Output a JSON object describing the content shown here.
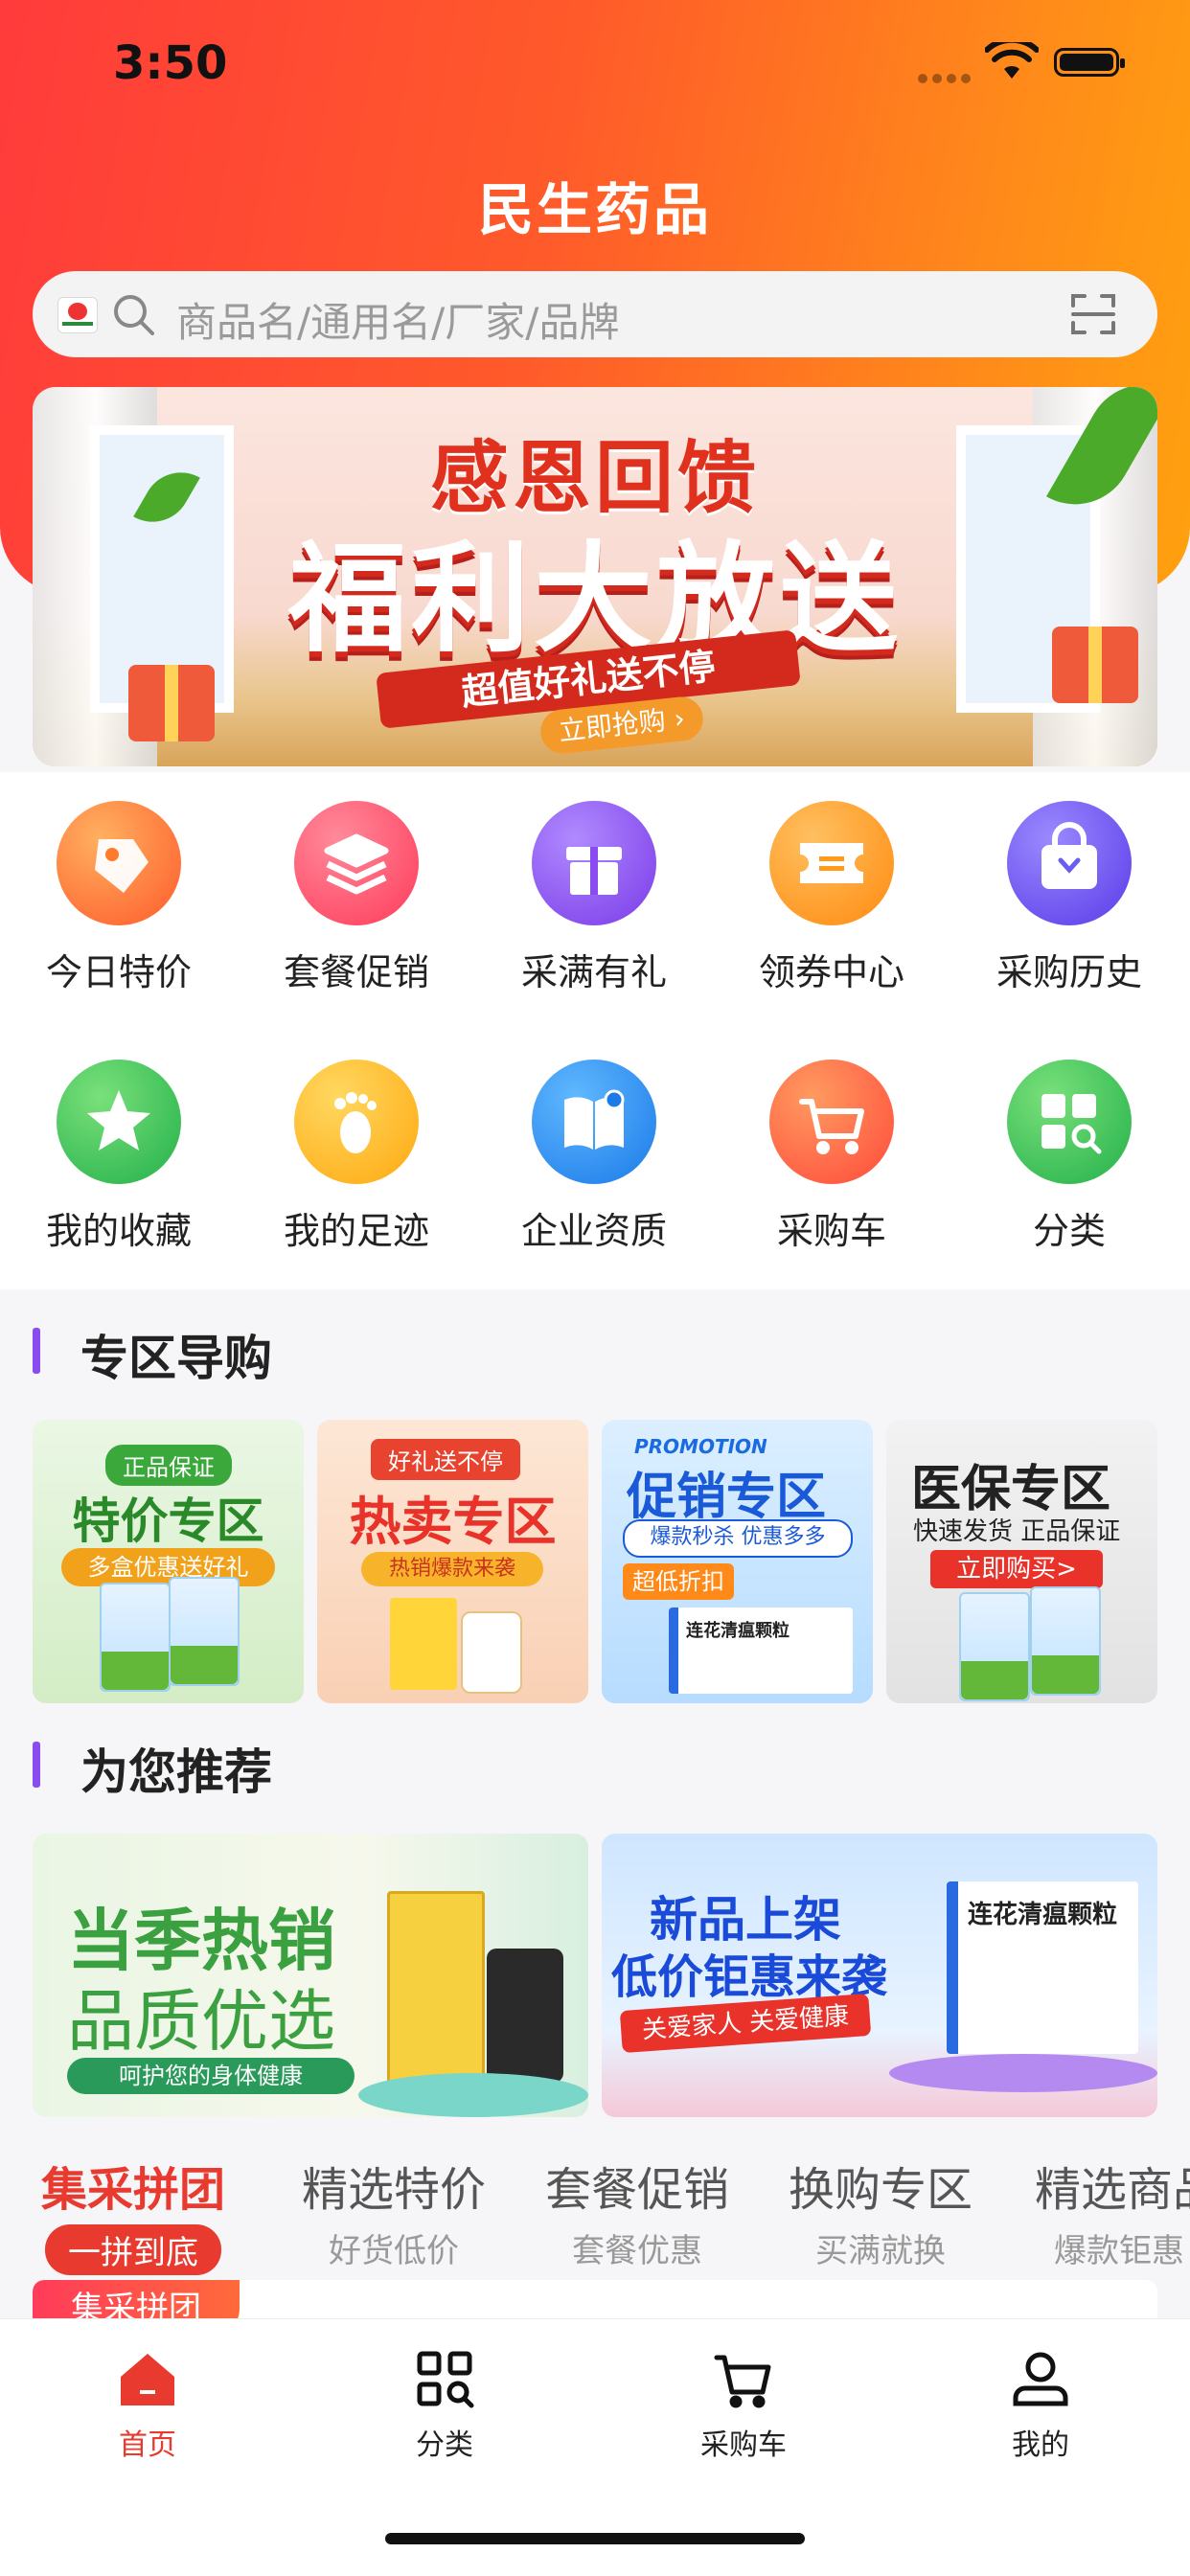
{
  "status": {
    "time": "3:50"
  },
  "header": {
    "title": "民生药品"
  },
  "search": {
    "placeholder": "商品名/通用名/厂家/品牌"
  },
  "banner": {
    "line1": "感恩回馈",
    "line2": "福利大放送",
    "line3": "超值好礼送不停",
    "cta": "立即抢购"
  },
  "grid": [
    {
      "label": "今日特价",
      "icon": "tag-icon",
      "color": "#ff7a2a"
    },
    {
      "label": "套餐促销",
      "icon": "layers-icon",
      "color": "#ff4d6a"
    },
    {
      "label": "采满有礼",
      "icon": "gift-icon",
      "color": "#8a4cf0"
    },
    {
      "label": "领券中心",
      "icon": "coupon-icon",
      "color": "#ff9a1a"
    },
    {
      "label": "采购历史",
      "icon": "bag-icon",
      "color": "#6a5cf0"
    },
    {
      "label": "我的收藏",
      "icon": "star-icon",
      "color": "#3cc05a"
    },
    {
      "label": "我的足迹",
      "icon": "footprint-icon",
      "color": "#ffb81a"
    },
    {
      "label": "企业资质",
      "icon": "book-icon",
      "color": "#2a8cf0"
    },
    {
      "label": "采购车",
      "icon": "cart-icon",
      "color": "#ff5a3a"
    },
    {
      "label": "分类",
      "icon": "category-icon",
      "color": "#3cc05a"
    }
  ],
  "zones_title": "专区导购",
  "zones": [
    {
      "tag": "正品保证",
      "title": "特价专区",
      "sub": "多盒优惠送好礼"
    },
    {
      "tag": "好礼送不停",
      "title": "热卖专区",
      "sub": "热销爆款来袭"
    },
    {
      "tag": "PROMOTION",
      "title": "促销专区",
      "sub": "爆款秒杀 优惠多多",
      "extra": "超低折扣",
      "product": "连花清瘟颗粒"
    },
    {
      "title": "医保专区",
      "sub": "快速发货 正品保证",
      "extra": "立即购买>"
    }
  ],
  "recommend_title": "为您推荐",
  "recommend": [
    {
      "line1": "当季热销",
      "line2": "品质优选",
      "sub": "呵护您的身体健康"
    },
    {
      "line1": "新品上架",
      "line2": "低价钜惠来袭",
      "sub": "关爱家人 关爱健康",
      "product": "连花清瘟颗粒"
    }
  ],
  "tabs": [
    {
      "title": "集采拼团",
      "sub": "一拼到底"
    },
    {
      "title": "精选特价",
      "sub": "好货低价"
    },
    {
      "title": "套餐促销",
      "sub": "套餐优惠"
    },
    {
      "title": "换购专区",
      "sub": "买满就换"
    },
    {
      "title": "精选商品",
      "sub": "爆款钜惠"
    }
  ],
  "strip_tag": "集采拼团",
  "nav": [
    {
      "label": "首页",
      "icon": "home-icon"
    },
    {
      "label": "分类",
      "icon": "category-icon"
    },
    {
      "label": "采购车",
      "icon": "cart-icon"
    },
    {
      "label": "我的",
      "icon": "user-icon"
    }
  ],
  "colors": {
    "accent": "#e83a2e",
    "header_start": "#ff3b3b",
    "header_end": "#ffa10f",
    "section_bar": "#8a4cf0"
  }
}
